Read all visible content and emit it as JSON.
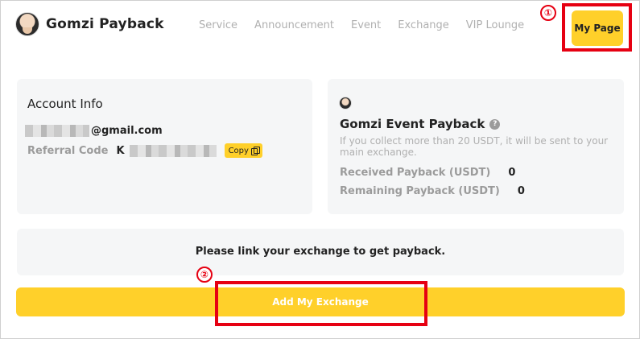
{
  "header": {
    "brand": "Gomzi Payback",
    "nav": [
      "Service",
      "Announcement",
      "Event",
      "Exchange",
      "VIP Lounge"
    ],
    "my_page_label": "My Page"
  },
  "annotations": {
    "marker_1": "①",
    "marker_2": "②",
    "highlight_color": "#e60012"
  },
  "account": {
    "title": "Account Info",
    "email_suffix": "@gmail.com",
    "referral_label": "Referral Code",
    "referral_prefix": "K",
    "copy_label": "Copy"
  },
  "event": {
    "title": "Gomzi Event Payback",
    "help_icon": "?",
    "description": "If you collect more than 20 USDT, it will be sent to your main exchange.",
    "received_label": "Received Payback (USDT)",
    "received_value": "0",
    "remaining_label": "Remaining Payback (USDT)",
    "remaining_value": "0"
  },
  "link_prompt": "Please link your exchange to get payback.",
  "add_button_label": "Add My Exchange",
  "colors": {
    "accent": "#ffd02a",
    "card_bg": "#f5f6f7",
    "muted_text": "#9b9b9b"
  }
}
